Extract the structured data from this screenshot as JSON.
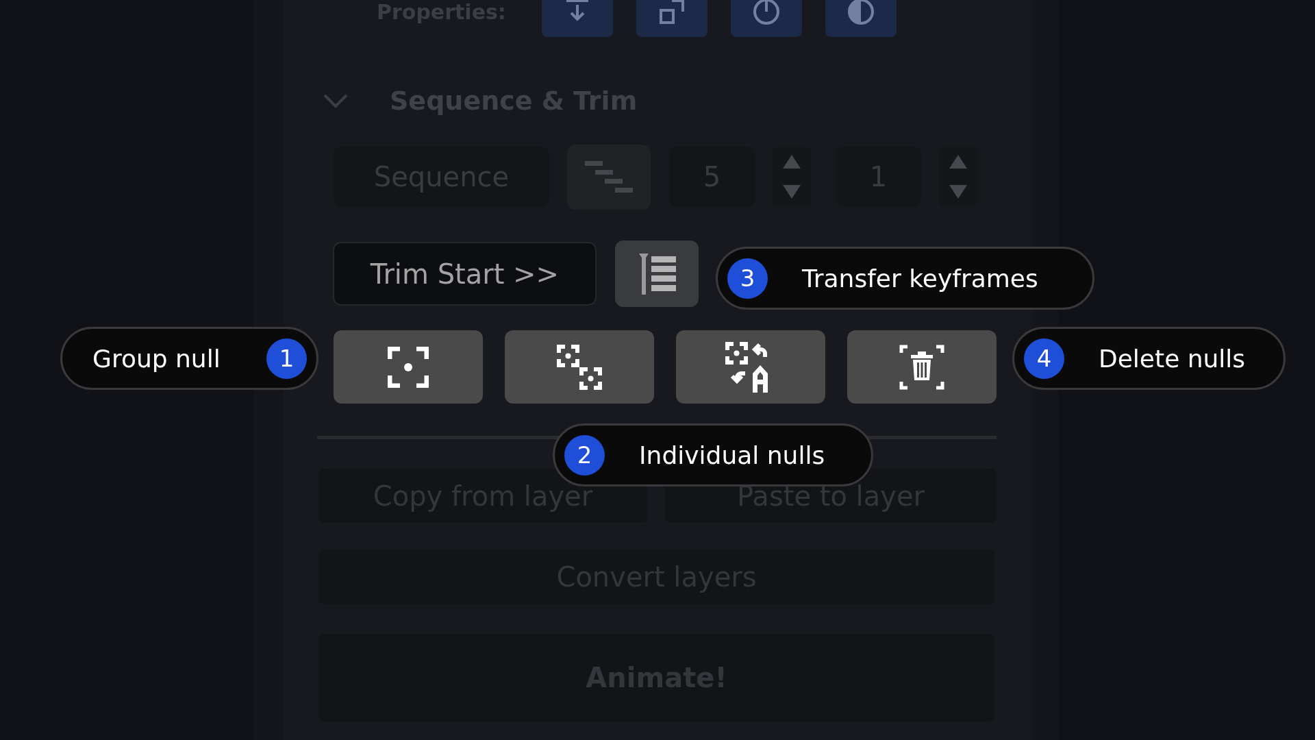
{
  "properties": {
    "label": "Properties:"
  },
  "section": {
    "title": "Sequence & Trim",
    "expanded": true
  },
  "sequence": {
    "label": "Sequence",
    "first": "5",
    "second": "1"
  },
  "trim": {
    "label": "Trim Start >>"
  },
  "layer_actions": [
    {
      "label": "Copy from layer"
    },
    {
      "label": "Paste to layer"
    }
  ],
  "convert": {
    "label": "Convert layers"
  },
  "animate": {
    "label": "Animate!"
  },
  "callouts": [
    {
      "number": "1",
      "label": "Group null"
    },
    {
      "number": "2",
      "label": "Individual nulls"
    },
    {
      "number": "3",
      "label": "Transfer keyframes"
    },
    {
      "number": "4",
      "label": "Delete nulls"
    }
  ]
}
